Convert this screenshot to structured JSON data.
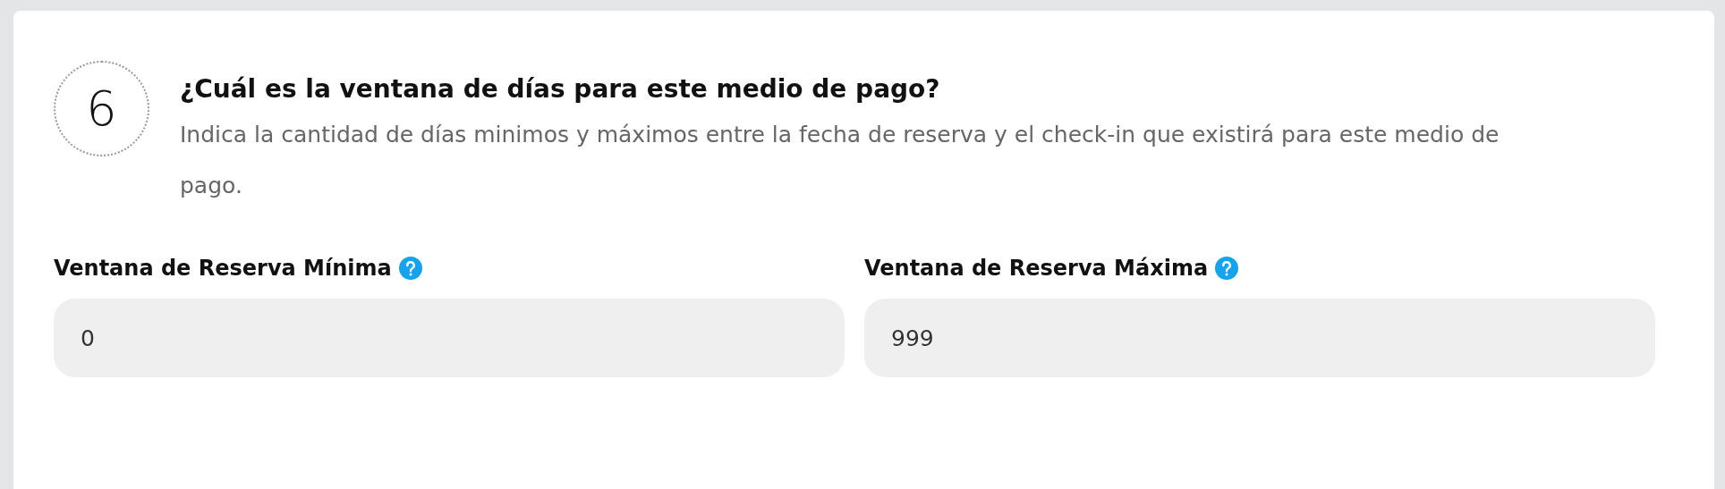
{
  "step": {
    "number": "6",
    "title": "¿Cuál es la ventana de días para este medio de pago?",
    "description": "Indica la cantidad de días minimos y máximos entre la fecha de reserva y el check-in que existirá para este medio de pago."
  },
  "fields": [
    {
      "label": "Ventana de Reserva Mínima",
      "value": "0"
    },
    {
      "label": "Ventana de Reserva Máxima",
      "value": "999"
    }
  ]
}
